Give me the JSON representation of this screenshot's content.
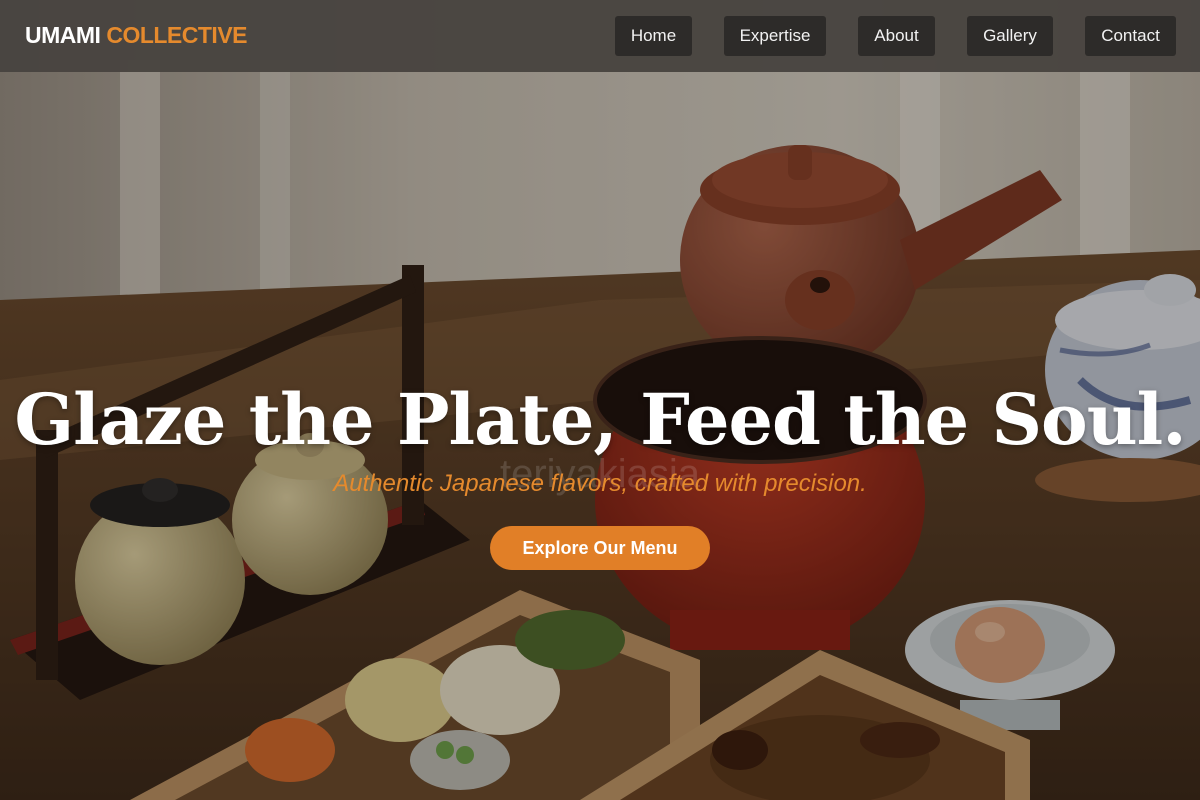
{
  "brand": {
    "name": "UMAMI",
    "accent": "COLLECTIVE"
  },
  "nav": {
    "items": [
      {
        "label": "Home"
      },
      {
        "label": "Expertise"
      },
      {
        "label": "About"
      },
      {
        "label": "Gallery"
      },
      {
        "label": "Contact"
      }
    ]
  },
  "hero": {
    "headline": "Glaze the Plate, Feed the Soul.",
    "subline": "Authentic Japanese flavors, crafted with precision.",
    "watermark": "teriyakiasia",
    "cta_label": "Explore Our Menu"
  },
  "colors": {
    "accent": "#e58a2d",
    "nav_bar": "#484440",
    "nav_button": "#2d2b29",
    "cta": "#e17f27"
  }
}
